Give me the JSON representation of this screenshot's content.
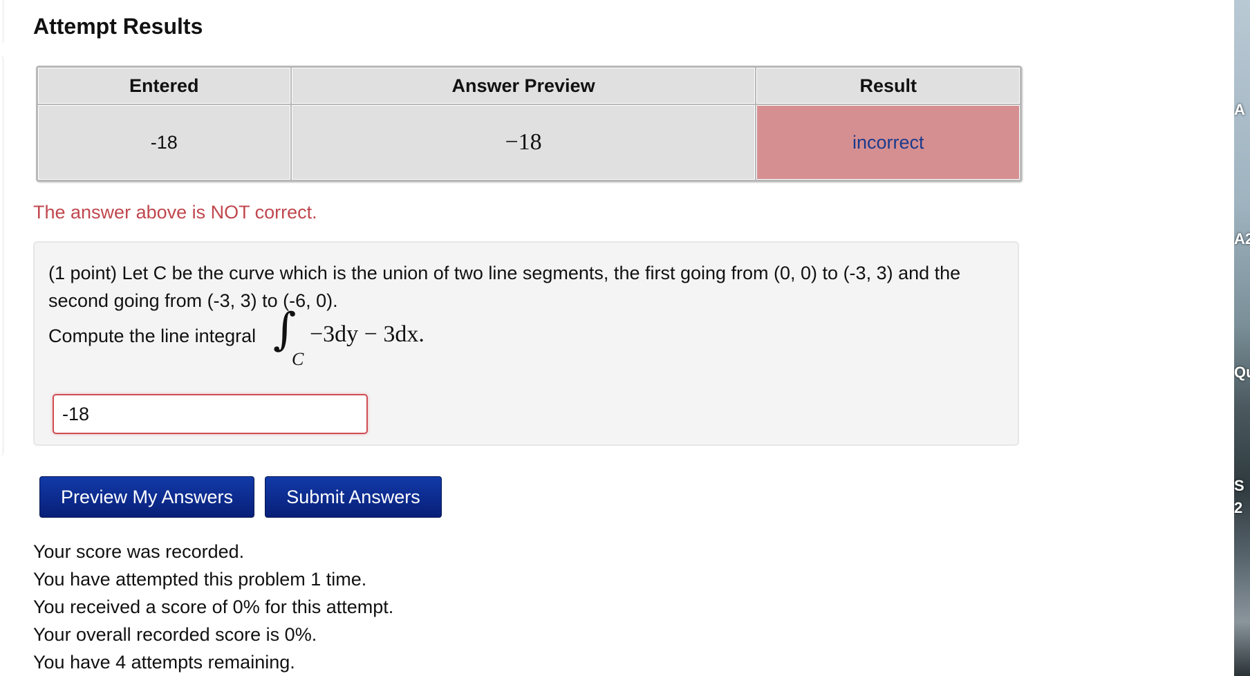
{
  "attempt": {
    "title": "Attempt Results",
    "table": {
      "headers": [
        "Entered",
        "Answer Preview",
        "Result"
      ],
      "row": {
        "entered": "-18",
        "preview": "−18",
        "result": "incorrect"
      }
    },
    "message": "The answer above is NOT correct."
  },
  "problem": {
    "statement": "(1 point) Let C be the curve which is the union of two line segments, the first going from (0, 0) to (-3, 3) and the second going from (-3, 3) to (-6, 0).",
    "prompt": "Compute the line integral",
    "integral_sign": "∫",
    "integral_subscript": "C",
    "integral_expression": "−3dy − 3dx.",
    "answer_value": "-18"
  },
  "buttons": {
    "preview": "Preview My Answers",
    "submit": "Submit Answers"
  },
  "score": {
    "lines": [
      "Your score was recorded.",
      "You have attempted this problem 1 time.",
      "You received a score of 0% for this attempt.",
      "Your overall recorded score is 0%.",
      "You have 4 attempts remaining."
    ]
  },
  "desktop_edge": {
    "labels": [
      "A",
      "A2",
      "Qu",
      "S",
      "2"
    ]
  },
  "colors": {
    "error_text": "#c0474e",
    "incorrect_cell": "#d68f91",
    "button_bg": "#0a2b8e",
    "input_border": "#d04c52"
  }
}
